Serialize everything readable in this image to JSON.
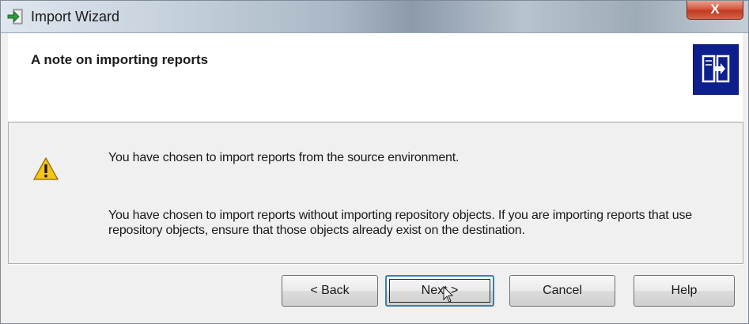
{
  "window": {
    "title": "Import Wizard",
    "close_label": "X"
  },
  "header": {
    "title": "A note on importing reports",
    "icon": "import-wizard-icon"
  },
  "content": {
    "warning_icon": "warning-icon",
    "message_1": "You have chosen to import reports from the source environment.",
    "message_2": "You have chosen to import reports without importing repository objects. If you are importing reports that use repository objects, ensure that those objects already exist on the destination."
  },
  "buttons": {
    "back": "< Back",
    "next": "Next >",
    "cancel": "Cancel",
    "help": "Help"
  },
  "colors": {
    "header_icon_bg": "#0d1f8c",
    "close_button": "#c13a1f",
    "warning_yellow": "#f5c518"
  }
}
